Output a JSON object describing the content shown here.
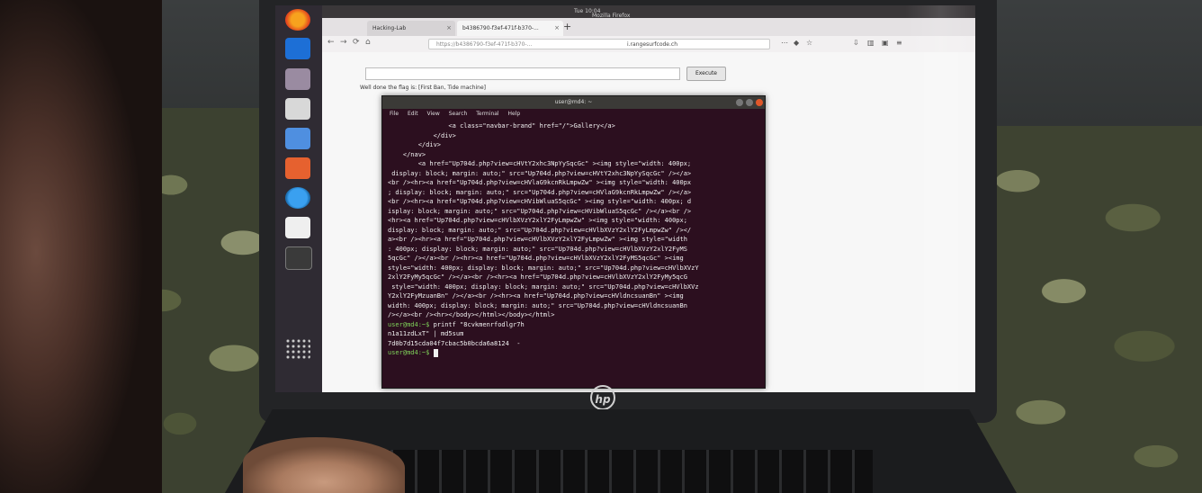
{
  "scene": {
    "description_type": "photo",
    "brand_logo": "hp"
  },
  "topbar": {
    "time": "Tue 10:04",
    "window_title": "Mozilla Firefox"
  },
  "browser": {
    "tabs": [
      {
        "label": "Hacking-Lab"
      },
      {
        "label": "b4386790-f3ef-471f-b370-..."
      }
    ],
    "url": "https://b4386790-f3ef-471f-b370-...",
    "url_domain": "i.rangesurfcode.ch",
    "execute_label": "Execute",
    "flag_hint": "Well done the flag is: [First Ban, Tide machine]"
  },
  "terminal": {
    "title": "user@md4: ~",
    "menu": [
      "File",
      "Edit",
      "View",
      "Search",
      "Terminal",
      "Help"
    ],
    "lines": [
      "                <a class=\"navbar-brand\" href=\"/\">Gallery</a>",
      "            </div>",
      "        </div>",
      "    </nav>",
      "        <a href=\"Up704d.php?view=cHVtY2xhc3NpYySqcGc\" ><img style=\"width: 400px;",
      " display: block; margin: auto;\" src=\"Up704d.php?view=cHVtY2xhc3NpYySqcGc\" /></a>",
      "<br /><hr><a href=\"Up704d.php?view=cHVlaG9kcnRkLmpwZw\" ><img style=\"width: 400px",
      "; display: block; margin: auto;\" src=\"Up704d.php?view=cHVlaG9kcnRkLmpwZw\" /></a>",
      "<br /><hr><a href=\"Up704d.php?view=cHVibWluaS5qcGc\" ><img style=\"width: 400px; d",
      "isplay: block; margin: auto;\" src=\"Up704d.php?view=cHVibWluaS5qcGc\" /></a><br />",
      "<hr><a href=\"Up704d.php?view=cHVlbXVzY2xlY2FyLmpwZw\" ><img style=\"width: 400px;",
      "display: block; margin: auto;\" src=\"Up704d.php?view=cHVlbXVzY2xlY2FyLmpwZw\" /></",
      "a><br /><hr><a href=\"Up704d.php?view=cHVlbXVzY2xlY2FyLmpwZw\" ><img style=\"width",
      ": 400px; display: block; margin: auto;\" src=\"Up704d.php?view=cHVlbXVzY2xlY2FyMS",
      "5qcGc\" /></a><br /><hr><a href=\"Up704d.php?view=cHVlbXVzY2xlY2FyMS5qcGc\" ><img",
      "style=\"width: 400px; display: block; margin: auto;\" src=\"Up704d.php?view=cHVlbXVzY",
      "2xlY2FyMy5qcGc\" /></a><br /><hr><a href=\"Up704d.php?view=cHVlbXVzY2xlY2FyMy5qcG",
      " style=\"width: 400px; display: block; margin: auto;\" src=\"Up704d.php?view=cHVlbXVz",
      "Y2xlY2FyMzuanBn\" /></a><br /><hr><a href=\"Up704d.php?view=cHVldncsuanBn\" ><img",
      "width: 400px; display: block; margin: auto;\" src=\"Up704d.php?view=cHVldncsuanBn",
      "/></a><br /><hr></body></html></body></html>"
    ],
    "prompt_line_1_prompt": "user@md4:~$",
    "prompt_line_1_cmd": " printf \"8cvkmenrfodlgr7h",
    "prompt_line_2": "n1a11zdLxT\" | md5sum",
    "output_line": "7d0b7d15cda04f7cbac5b0bcda6a8124  -",
    "prompt_final": "user@md4:~$"
  }
}
